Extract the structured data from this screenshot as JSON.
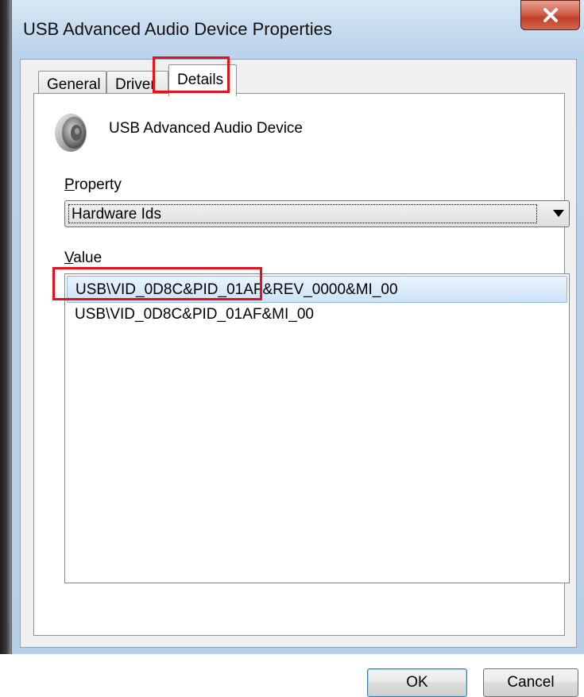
{
  "window": {
    "title": "USB Advanced Audio Device Properties",
    "close_glyph": "x"
  },
  "tabs": [
    {
      "label": "General",
      "active": false
    },
    {
      "label": "Driver",
      "active": false
    },
    {
      "label": "Details",
      "active": true
    }
  ],
  "device": {
    "icon": "speaker-icon",
    "name": "USB Advanced Audio Device"
  },
  "property": {
    "label_accel": "P",
    "label_rest": "roperty",
    "selected": "Hardware Ids"
  },
  "value": {
    "label_accel": "V",
    "label_rest": "alue",
    "items": [
      "USB\\VID_0D8C&PID_01AF&REV_0000&MI_00",
      "USB\\VID_0D8C&PID_01AF&MI_00"
    ],
    "selected_index": 0
  },
  "buttons": {
    "ok": "OK",
    "cancel": "Cancel"
  },
  "colors": {
    "annotation": "#e5121c",
    "selection": "#cde3f8"
  }
}
